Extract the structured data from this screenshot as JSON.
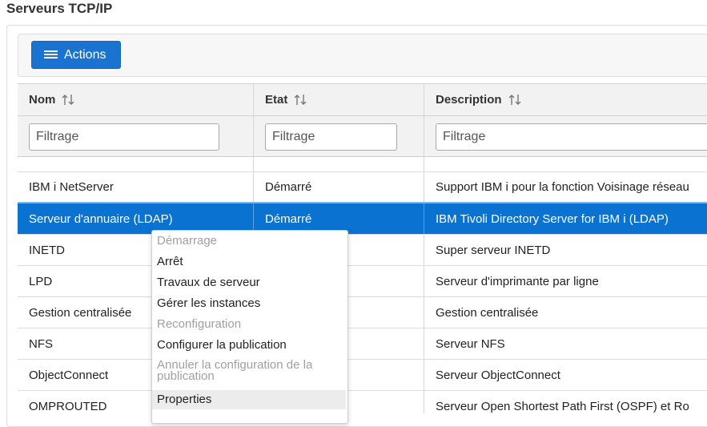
{
  "page": {
    "title": "Serveurs TCP/IP"
  },
  "toolbar": {
    "actions_label": "Actions"
  },
  "table": {
    "columns": [
      {
        "label": "Nom",
        "filter_placeholder": "Filtrage"
      },
      {
        "label": "Etat",
        "filter_placeholder": "Filtrage"
      },
      {
        "label": "Description",
        "filter_placeholder": "Filtrage"
      }
    ],
    "rows": [
      {
        "name": "IBM i NetServer",
        "state": "Démarré",
        "description": "Support IBM i pour la fonction Voisinage réseau"
      },
      {
        "name": "Serveur d'annuaire (LDAP)",
        "state": "Démarré",
        "description": "IBM Tivoli Directory Server for IBM i (LDAP)",
        "selected": true
      },
      {
        "name": "INETD",
        "state": "",
        "description": "Super serveur INETD"
      },
      {
        "name": "LPD",
        "state": "",
        "description": "Serveur d'imprimante par ligne"
      },
      {
        "name": "Gestion centralisée",
        "state": "",
        "description": "Gestion centralisée"
      },
      {
        "name": "NFS",
        "state": "",
        "description": "Serveur NFS"
      },
      {
        "name": "ObjectConnect",
        "state": "",
        "description": "Serveur ObjectConnect"
      },
      {
        "name": "OMPROUTED",
        "state": "",
        "description": "Serveur Open Shortest Path First (OSPF) et Ro"
      }
    ]
  },
  "context_menu": {
    "items": [
      {
        "label": "Démarrage",
        "disabled": true
      },
      {
        "label": "Arrêt",
        "disabled": false
      },
      {
        "label": "Travaux de serveur",
        "disabled": false
      },
      {
        "label": "Gérer les instances",
        "disabled": false
      },
      {
        "label": "Reconfiguration",
        "disabled": true
      },
      {
        "label": "Configurer la publication",
        "disabled": false
      },
      {
        "label": "Annuler la configuration de la publication",
        "disabled": true
      },
      {
        "label": "Properties",
        "disabled": false,
        "hovered": true
      }
    ]
  },
  "colors": {
    "accent": "#1a73d1",
    "selected_row": "#0a73d2"
  },
  "icons": {
    "actions": "hamburger-menu-icon",
    "sort": "sort-updown-icon"
  }
}
